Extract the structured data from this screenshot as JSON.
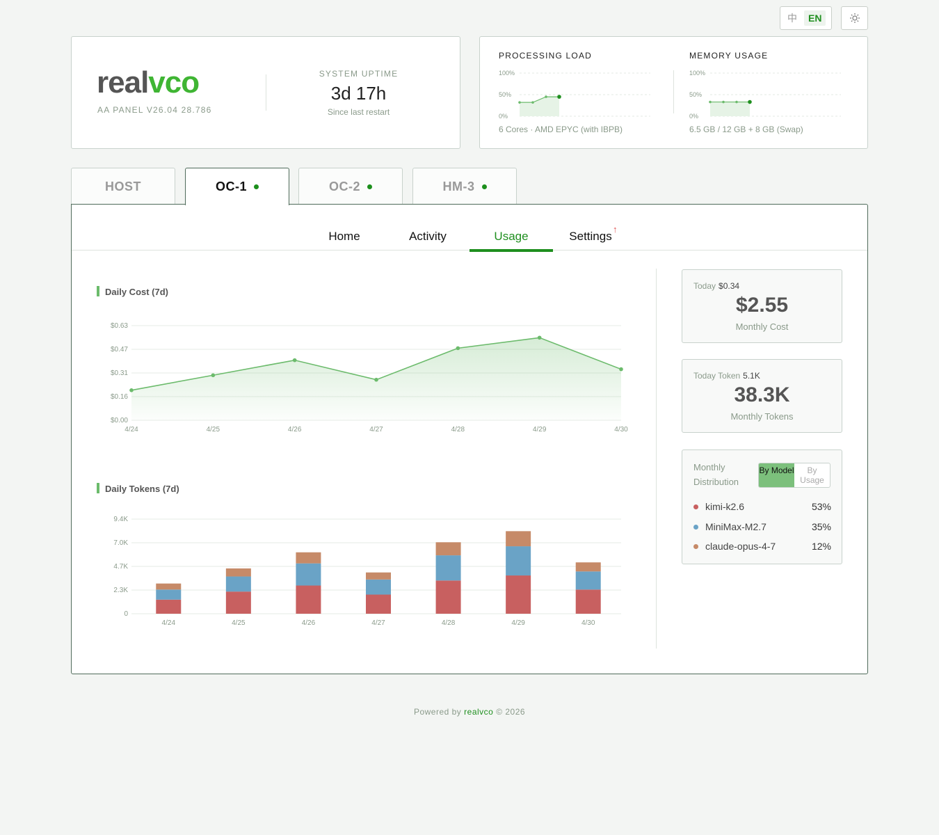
{
  "lang": {
    "zh": "中",
    "en": "EN"
  },
  "brand": {
    "name_gray": "real",
    "name_green": "vco",
    "version": "AA PANEL V26.04 28.786"
  },
  "uptime": {
    "label": "SYSTEM UPTIME",
    "value": "3d 17h",
    "sub": "Since last restart"
  },
  "processing": {
    "title": "PROCESSING LOAD",
    "ticks": [
      "100%",
      "50%",
      "0%"
    ],
    "desc": "6 Cores · AMD EPYC (with IBPB)",
    "points": [
      32,
      32,
      45,
      45
    ]
  },
  "memory": {
    "title": "MEMORY USAGE",
    "ticks": [
      "100%",
      "50%",
      "0%"
    ],
    "desc": "6.5 GB / 12 GB + 8 GB (Swap)",
    "points": [
      33,
      33,
      33,
      33
    ]
  },
  "tabs": [
    {
      "label": "HOST",
      "dot": false
    },
    {
      "label": "OC-1",
      "dot": true
    },
    {
      "label": "OC-2",
      "dot": true
    },
    {
      "label": "HM-3",
      "dot": true
    }
  ],
  "subnav": [
    "Home",
    "Activity",
    "Usage",
    "Settings"
  ],
  "cost_title": "Daily Cost (7d)",
  "tokens_title": "Daily Tokens (7d)",
  "chart_data": [
    {
      "type": "area",
      "title": "Daily Cost (7d)",
      "categories": [
        "4/24",
        "4/25",
        "4/26",
        "4/27",
        "4/28",
        "4/29",
        "4/30"
      ],
      "values": [
        0.2,
        0.3,
        0.4,
        0.27,
        0.48,
        0.55,
        0.34
      ],
      "yticks": [
        "$0.63",
        "$0.47",
        "$0.31",
        "$0.16",
        "$0.00"
      ],
      "ylim": [
        0,
        0.63
      ],
      "color": "#6cbb6c"
    },
    {
      "type": "bar",
      "stacked": true,
      "title": "Daily Tokens (7d)",
      "categories": [
        "4/24",
        "4/25",
        "4/26",
        "4/27",
        "4/28",
        "4/29",
        "4/30"
      ],
      "yticks": [
        "9.4K",
        "7.0K",
        "4.7K",
        "2.3K",
        "0"
      ],
      "ylim": [
        0,
        9.4
      ],
      "series": [
        {
          "name": "kimi-k2.6",
          "color": "#c86060",
          "values": [
            1.4,
            2.2,
            2.8,
            1.9,
            3.3,
            3.8,
            2.4
          ]
        },
        {
          "name": "MiniMax-M2.7",
          "color": "#6aa3c6",
          "values": [
            1.0,
            1.5,
            2.2,
            1.5,
            2.5,
            2.9,
            1.8
          ]
        },
        {
          "name": "claude-opus-4-7",
          "color": "#c68a68",
          "values": [
            0.6,
            0.8,
            1.1,
            0.7,
            1.3,
            1.5,
            0.9
          ]
        }
      ]
    }
  ],
  "cost_card": {
    "label": "Today",
    "today": "$0.34",
    "value": "$2.55",
    "caption": "Monthly Cost"
  },
  "token_card": {
    "label": "Today Token",
    "today": "5.1K",
    "value": "38.3K",
    "caption": "Monthly Tokens"
  },
  "distribution": {
    "title": "Monthly Distribution",
    "by_model": "By Model",
    "by_usage": "By Usage",
    "items": [
      {
        "name": "kimi-k2.6",
        "pct": "53%",
        "color": "#c86060"
      },
      {
        "name": "MiniMax-M2.7",
        "pct": "35%",
        "color": "#6aa3c6"
      },
      {
        "name": "claude-opus-4-7",
        "pct": "12%",
        "color": "#c68a68"
      }
    ]
  },
  "footer": {
    "prefix": "Powered by",
    "brand": "realvco",
    "suffix": "© 2026"
  }
}
